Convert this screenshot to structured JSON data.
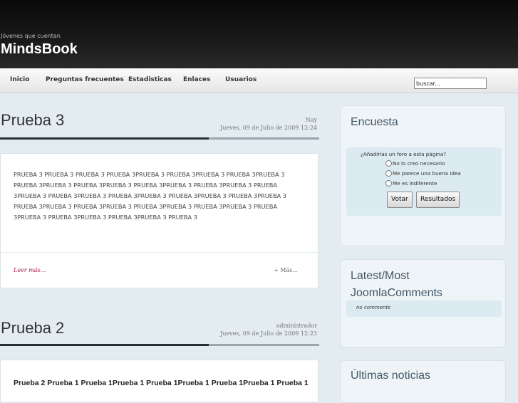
{
  "site": {
    "tagline": "Jóvenes que cuentan",
    "name": "MindsBook"
  },
  "nav": {
    "items": [
      "Inicio",
      "Preguntas frecuentes",
      "Estadisticas",
      "Enlaces",
      "Usuarios"
    ]
  },
  "search": {
    "value": "buscar..."
  },
  "articles": [
    {
      "title": "Prueba 3",
      "author": "Nay",
      "date": "Jueves, 09 de Julio de 2009 12:24",
      "lines": [
        "PRUEBA 3 PRUEBA 3 PRUEBA 3 PRUEBA 3PRUEBA 3 PRUEBA 3PRUEBA 3 PRUEBA 3PRUEBA 3",
        "PRUEBA 3PRUEBA 3 PRUEBA 3PRUEBA 3 PRUEBA 3PRUEBA 3 PRUEBA 3PRUEBA 3 PRUEBA",
        "3PRUEBA 3 PRUEBA 3PRUEBA 3 PRUEBA 3PRUEBA 3 PRUEBA 3PRUEBA 3 PRUEBA 3PRUEBA 3",
        "PRUEBA 3PRUEBA 3 PRUEBA 3PRUEBA 3 PRUEBA 3PRUEBA 3 PRUEBA 3PRUEBA 3 PRUEBA",
        "3PRUEBA 3 PRUEBA 3PRUEBA 3 PRUEBA 3PRUEBA 3 PRUEBA 3"
      ],
      "read_more": "Leer más...",
      "more": "+ Más..."
    },
    {
      "title": "Prueba 2",
      "author": "administrador",
      "date": "Jueves, 09 de Julio de 2009 12:23",
      "lines": [
        "Prueba 2 Prueba 1 Prueba 1Prueba 1 Prueba 1Prueba 1 Prueba 1Prueba 1 Prueba 1"
      ]
    }
  ],
  "poll": {
    "title": "Encuesta",
    "question": "¿Añadirías un foro a esta página?",
    "options": [
      "No lo creo necesario",
      "Me parece una buena idea",
      "Me es indiferente"
    ],
    "vote_label": "Votar",
    "results_label": "Resultados"
  },
  "comments": {
    "title_line1": "Latest/Most",
    "title_line2": "JoomlaComments",
    "empty": "no comments"
  },
  "news": {
    "title": "Últimas noticias"
  }
}
